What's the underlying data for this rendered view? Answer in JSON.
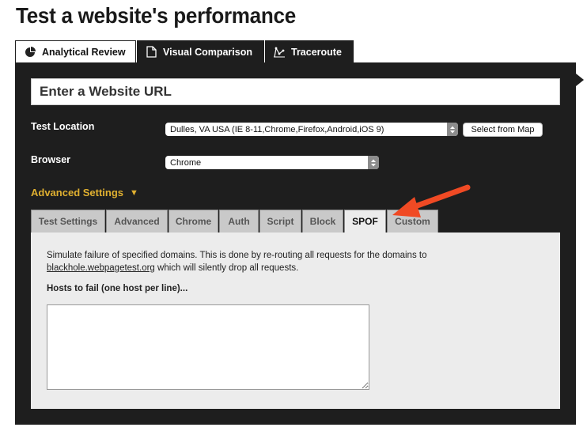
{
  "page": {
    "title": "Test a website's performance"
  },
  "main_tabs": [
    {
      "label": "Analytical Review",
      "icon": "pie-chart-icon",
      "active": true
    },
    {
      "label": "Visual Comparison",
      "icon": "document-icon",
      "active": false
    },
    {
      "label": "Traceroute",
      "icon": "traceroute-icon",
      "active": false
    }
  ],
  "url_input": {
    "placeholder": "Enter a Website URL",
    "value": ""
  },
  "test_location": {
    "label": "Test Location",
    "selected": "Dulles, VA USA (IE 8-11,Chrome,Firefox,Android,iOS 9)",
    "map_button": "Select from Map"
  },
  "browser": {
    "label": "Browser",
    "selected": "Chrome"
  },
  "advanced": {
    "label": "Advanced Settings"
  },
  "sub_tabs": [
    {
      "label": "Test Settings",
      "active": false
    },
    {
      "label": "Advanced",
      "active": false
    },
    {
      "label": "Chrome",
      "active": false
    },
    {
      "label": "Auth",
      "active": false
    },
    {
      "label": "Script",
      "active": false
    },
    {
      "label": "Block",
      "active": false
    },
    {
      "label": "SPOF",
      "active": true
    },
    {
      "label": "Custom",
      "active": false
    }
  ],
  "spof": {
    "description_line1": "Simulate failure of specified domains. This is done by re-routing all requests for the domains to",
    "link": "blackhole.webpagetest.org",
    "description_line2": " which will silently drop all requests.",
    "hosts_label": "Hosts to fail (one host per line)...",
    "hosts_value": ""
  },
  "colors": {
    "panel_bg": "#1e1e1e",
    "accent_yellow": "#e0b030",
    "annotation_arrow": "#f04a24",
    "content_bg": "#ececec"
  }
}
